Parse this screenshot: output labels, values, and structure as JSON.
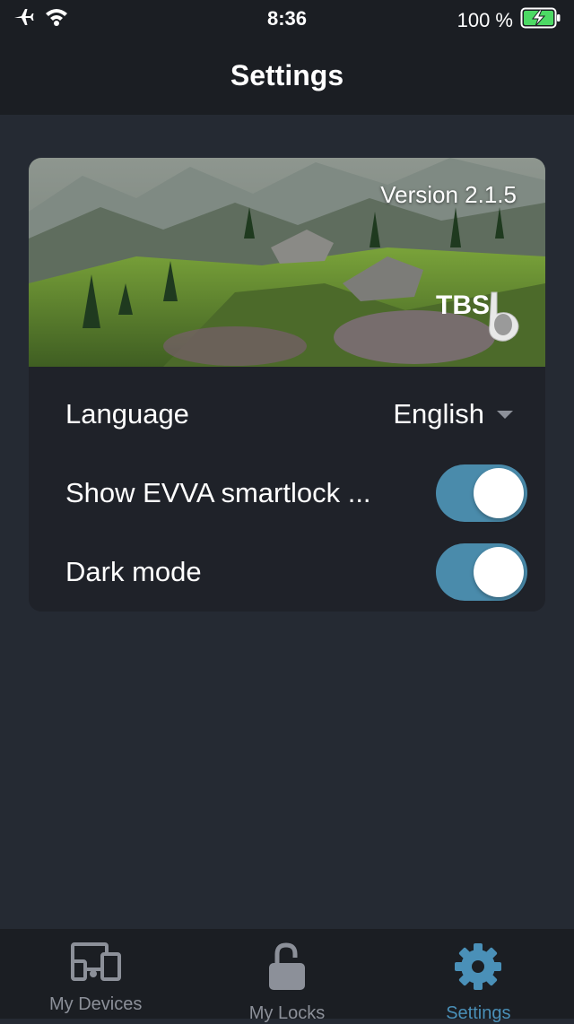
{
  "status_bar": {
    "time": "8:36",
    "battery": "100 %",
    "icons": [
      "airplane-icon",
      "wifi-icon",
      "battery-charging-icon"
    ]
  },
  "nav": {
    "title": "Settings"
  },
  "banner": {
    "version": "Version 2.1.5",
    "logo_text": "TBS"
  },
  "settings": {
    "language_label": "Language",
    "language_value": "English",
    "evva_label": "Show EVVA smartlock ...",
    "evva_enabled": true,
    "dark_label": "Dark mode",
    "dark_enabled": true
  },
  "tabs": [
    {
      "label": "My Devices",
      "icon": "devices-icon",
      "active": false
    },
    {
      "label": "My Locks",
      "icon": "lock-icon",
      "active": false
    },
    {
      "label": "Settings",
      "icon": "gear-icon",
      "active": true
    }
  ],
  "colors": {
    "background": "#252a33",
    "bar": "#1b1e23",
    "card": "#1f2229",
    "accent": "#4a90b8",
    "toggle_on": "#4a8bab",
    "battery_green": "#4cd964"
  }
}
